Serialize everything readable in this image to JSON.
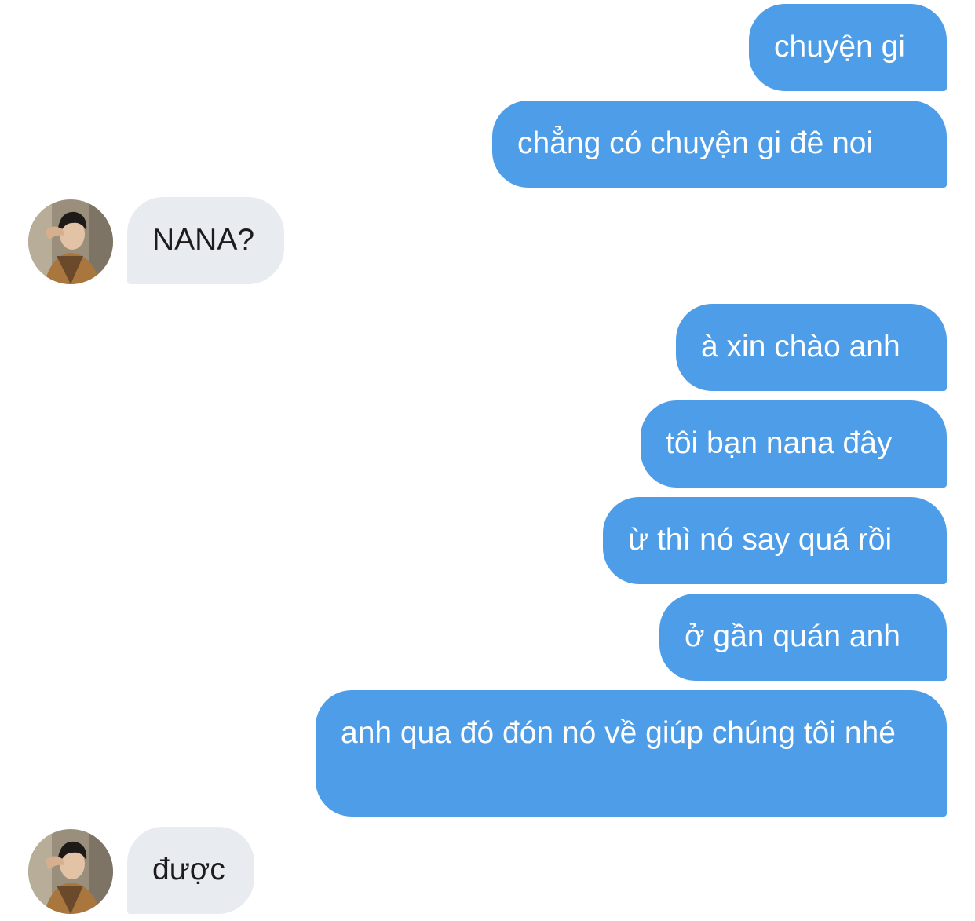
{
  "conversation": {
    "messages": [
      {
        "sender": "me",
        "text": "chuyện gi"
      },
      {
        "sender": "me",
        "text": "chẳng có chuyện gi đê noi"
      },
      {
        "sender": "contact",
        "text": "NANA?"
      },
      {
        "sender": "me",
        "text": "à xin chào anh"
      },
      {
        "sender": "me",
        "text": "tôi bạn nana đây"
      },
      {
        "sender": "me",
        "text": "ừ thì nó say quá rồi"
      },
      {
        "sender": "me",
        "text": "ở gần quán anh"
      },
      {
        "sender": "me",
        "text": "anh qua đó đón nó về giúp chúng tôi nhé"
      },
      {
        "sender": "contact",
        "text": "được"
      }
    ]
  },
  "colors": {
    "outgoing_bubble": "#4d9de8",
    "incoming_bubble": "#e8ebf0",
    "outgoing_text": "#ffffff",
    "incoming_text": "#1c1c1e"
  },
  "icons": {
    "contact_avatar": "avatar-photo"
  }
}
